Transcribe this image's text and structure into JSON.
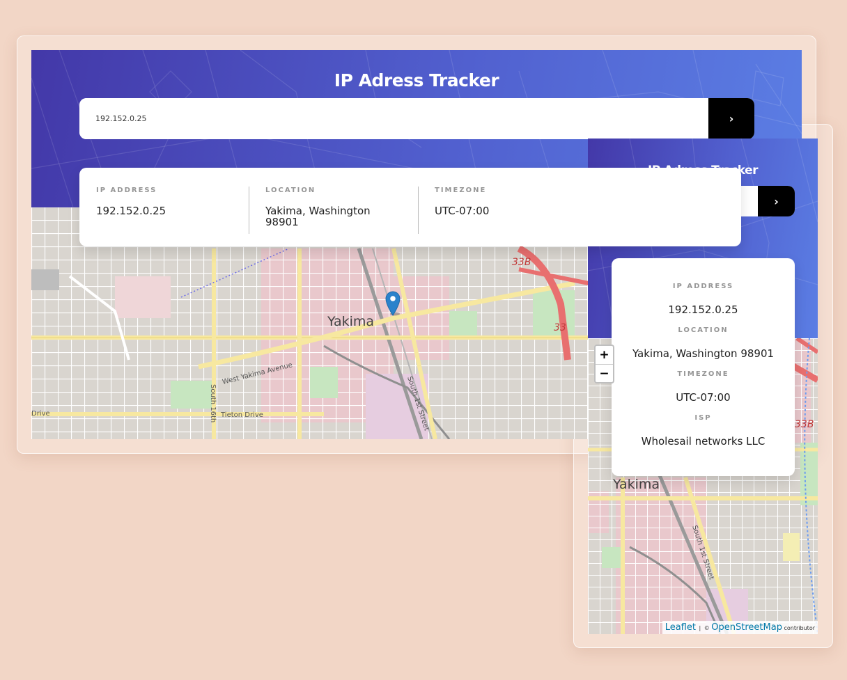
{
  "app": {
    "title": "IP Adress Tracker",
    "search_value": "192.152.0.25",
    "submit_icon": "chevron-right",
    "submit_glyph": "›"
  },
  "desktop": {
    "stats": [
      {
        "label": "IP ADDRESS",
        "value": "192.152.0.25"
      },
      {
        "label": "LOCATION",
        "value": "Yakima, Washington 98901"
      },
      {
        "label": "TIMEZONE",
        "value": "UTC-07:00"
      }
    ]
  },
  "mobile": {
    "stats": [
      {
        "label": "IP ADDRESS",
        "value": "192.152.0.25"
      },
      {
        "label": "LOCATION",
        "value": "Yakima, Washington 98901"
      },
      {
        "label": "TIMEZONE",
        "value": "UTC-07:00"
      },
      {
        "label": "ISP",
        "value": "Wholesail networks LLC"
      }
    ],
    "zoom_in": "+",
    "zoom_out": "−"
  },
  "map": {
    "city": "Yakima",
    "streets": [
      "West Yakima Avenue",
      "South 1st Street",
      "South 16th",
      "Tieton Drive",
      "Drive"
    ],
    "routes": [
      "33B",
      "33"
    ],
    "marker_icon": "map-pin"
  },
  "attribution": {
    "leaflet": "Leaflet",
    "separator": "|",
    "copyright": "©",
    "osm": "OpenStreetMap",
    "tail": "contributor"
  },
  "colors": {
    "background": "#f2d6c6",
    "hero_start": "#4338a8",
    "hero_end": "#5b7ee4",
    "button": "#000000",
    "label_gray": "#969696",
    "marker": "#2a82cb"
  }
}
